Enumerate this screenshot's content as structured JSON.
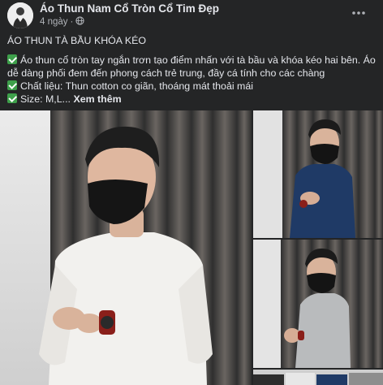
{
  "header": {
    "page_name": "Áo Thun Nam Cổ Tròn Cổ Tim Đẹp",
    "time": "4 ngày",
    "separator": "·"
  },
  "post": {
    "title": "ÁO THUN TÀ BẦU KHÓA KÉO",
    "lines": [
      "Áo thun cổ tròn tay ngắn trơn tạo điểm nhấn với tà bầu và khóa kéo hai bên. Áo dễ dàng phối đem đến phong cách trẻ trung, đầy cá tính cho các chàng",
      "Chất liệu: Thun cotton co giãn, thoáng mát thoải mái",
      "Size: M,L..."
    ],
    "see_more": "Xem thêm"
  },
  "icons": {
    "avatar": "avatar-image",
    "globe": "globe-icon",
    "more": "more-options-icon",
    "check": "check-mark-emoji"
  },
  "colors": {
    "background": "#242526",
    "primary_text": "#e4e6eb",
    "secondary_text": "#b0b3b8",
    "check_green": "#3ea04b"
  }
}
